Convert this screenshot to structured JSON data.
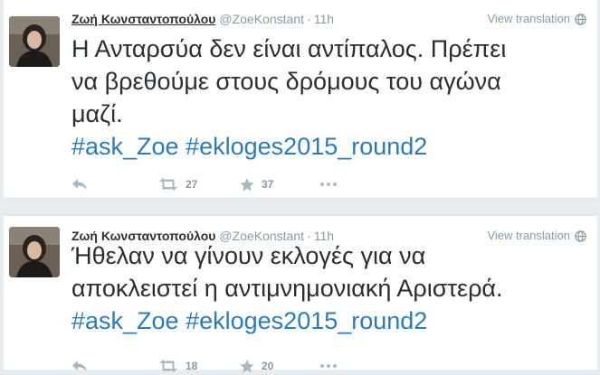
{
  "colors": {
    "background": "#e6ecf0",
    "card": "#ffffff",
    "text": "#292f33",
    "muted": "#8899a6",
    "hashtag": "#2b7bb9"
  },
  "icons": [
    "globe-icon",
    "reply-icon",
    "retweet-icon",
    "favorite-star-icon",
    "more-dots-icon"
  ],
  "tweets": [
    {
      "name": "Ζωή Κωνσταντοπούλου",
      "handle": "@ZoeKonstant",
      "separator": "·",
      "time": "11h",
      "translate_label": "View translation",
      "text_line1": "Η Ανταρσύα δεν είναι αντίπαλος. Πρέπει",
      "text_line2": "να βρεθούμε στους δρόμους του αγώνα",
      "text_line3": "μαζί.",
      "hashtag1": "#ask_Zoe",
      "hashtag2": "#ekloges2015_round2",
      "retweets": "27",
      "favorites": "37"
    },
    {
      "name": "Ζωή Κωνσταντοπούλου",
      "handle": "@ZoeKonstant",
      "separator": "·",
      "time": "11h",
      "translate_label": "View translation",
      "text_line1": "Ήθελαν να γίνουν εκλογές για να",
      "text_line2": "αποκλειστεί η αντιμνημονιακή Αριστερά.",
      "hashtag1": "#ask_Zoe",
      "hashtag2": "#ekloges2015_round2",
      "retweets": "18",
      "favorites": "20"
    }
  ]
}
